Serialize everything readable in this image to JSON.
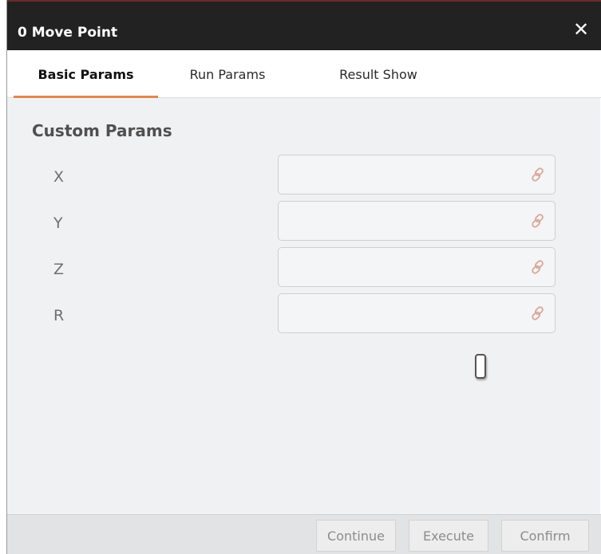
{
  "window": {
    "title": "0 Move Point",
    "close_glyph": "✕"
  },
  "tabs": [
    {
      "label": "Basic Params",
      "active": true
    },
    {
      "label": "Run Params",
      "active": false
    },
    {
      "label": "Result Show",
      "active": false
    }
  ],
  "custom_params": {
    "title": "Custom Params",
    "fields": [
      {
        "label": "X",
        "value": "",
        "icon": "link-icon"
      },
      {
        "label": "Y",
        "value": "",
        "icon": "link-icon"
      },
      {
        "label": "Z",
        "value": "",
        "icon": "link-icon"
      },
      {
        "label": "R",
        "value": "",
        "icon": "link-icon"
      }
    ]
  },
  "footer": {
    "buttons": [
      {
        "label": "Continue"
      },
      {
        "label": "Execute"
      },
      {
        "label": "Confirm"
      }
    ]
  },
  "colors": {
    "titlebar": "#222222",
    "tab_accent": "#e0884f",
    "link_icon": "#d9a898",
    "panel_bg": "#f0f1f3"
  }
}
